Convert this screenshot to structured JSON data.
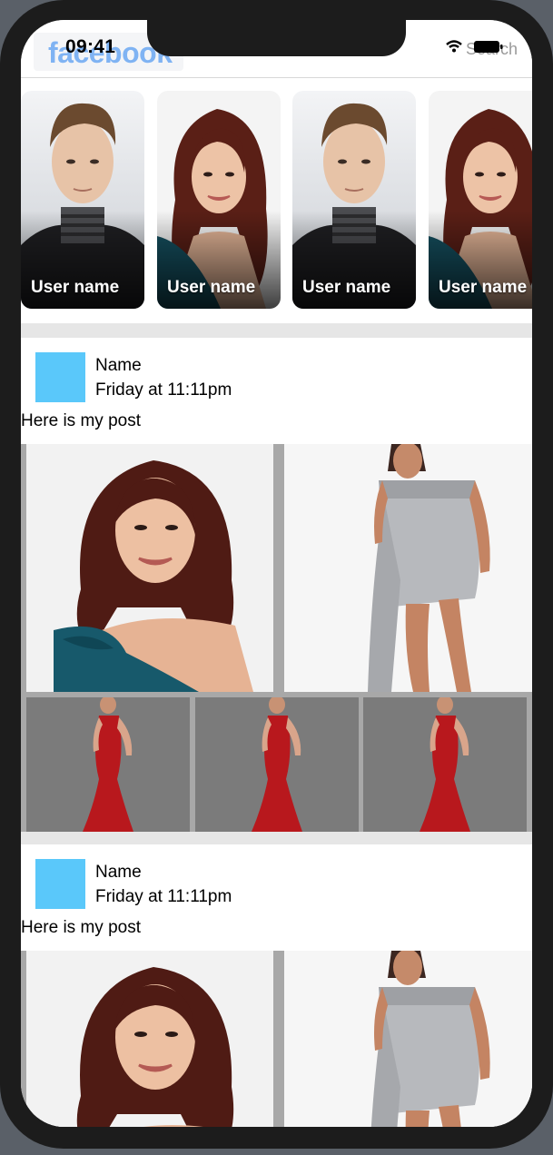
{
  "status_bar": {
    "time": "09:41"
  },
  "header": {
    "logo": "facebook",
    "search_placeholder": "Search"
  },
  "stories": [
    {
      "label": "User name",
      "photo": "man-portrait"
    },
    {
      "label": "User name",
      "photo": "woman-portrait"
    },
    {
      "label": "User name",
      "photo": "man-portrait"
    },
    {
      "label": "User name",
      "photo": "woman-portrait"
    }
  ],
  "posts": [
    {
      "author": "Name",
      "time": "Friday at 11:11pm",
      "text": "Here is my post",
      "photos_top": [
        "woman-portrait",
        "silver-dress"
      ],
      "photos_bottom": [
        "red-gown",
        "red-gown",
        "red-gown"
      ]
    },
    {
      "author": "Name",
      "time": "Friday at 11:11pm",
      "text": "Here is my post",
      "photos_top": [
        "woman-portrait",
        "silver-dress"
      ]
    }
  ],
  "colors": {
    "avatar": "#5ac8fa",
    "logo": "#7fb3f3",
    "divider": "#e6e6e6"
  }
}
